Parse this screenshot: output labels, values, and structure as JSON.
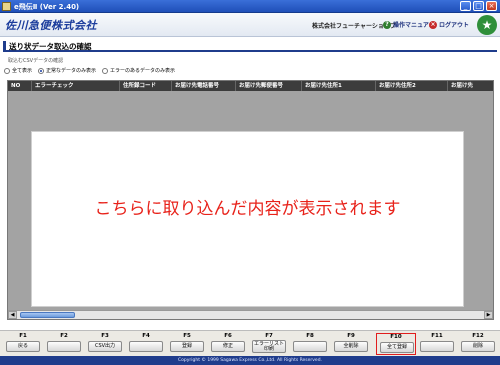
{
  "window": {
    "title": "e飛伝Ⅱ (Ver 2.40)",
    "min": "_",
    "max": "□",
    "close": "×"
  },
  "header": {
    "logo": "佐川急便株式会社",
    "company": "株式会社フューチャーショップ",
    "manual_label": "操作マニュアル",
    "logout_label": "ログアウト"
  },
  "screen": {
    "title": "送り状データ取込の確認",
    "subcaption": "取込むCSVデータの確認",
    "filters": [
      {
        "label": "全て表示",
        "selected": false
      },
      {
        "label": "正常なデータのみ表示",
        "selected": true
      },
      {
        "label": "エラーのあるデータのみ表示",
        "selected": false
      }
    ]
  },
  "table": {
    "columns": [
      "NO",
      "エラーチェック",
      "住所録コード",
      "お届け先電話番号",
      "お届け先郵便番号",
      "お届け先住所1",
      "お届け先住所2",
      "お届け先"
    ],
    "placeholder": "こちらに取り込んだ内容が表示されます"
  },
  "fkeys": [
    {
      "key": "F1",
      "label": "戻る"
    },
    {
      "key": "F2",
      "label": ""
    },
    {
      "key": "F3",
      "label": "CSV出力"
    },
    {
      "key": "F4",
      "label": ""
    },
    {
      "key": "F5",
      "label": "登録"
    },
    {
      "key": "F6",
      "label": "修正"
    },
    {
      "key": "F7",
      "label": "エラーリスト印刷"
    },
    {
      "key": "F8",
      "label": ""
    },
    {
      "key": "F9",
      "label": "全削除"
    },
    {
      "key": "F10",
      "label": "全て登録"
    },
    {
      "key": "F11",
      "label": ""
    },
    {
      "key": "F12",
      "label": "削除"
    }
  ],
  "footer": "Copyright © 1999 Sagawa Express Co.,Ltd. All Rights Reserved."
}
